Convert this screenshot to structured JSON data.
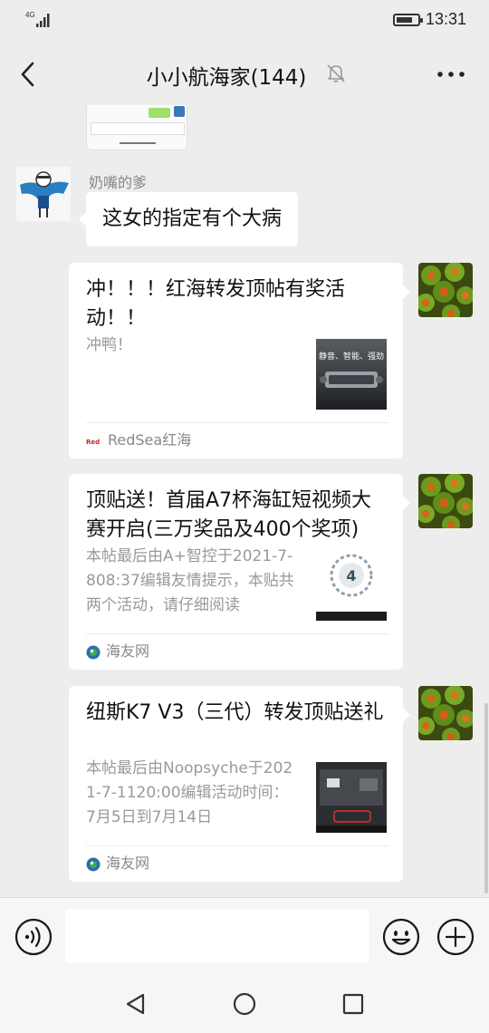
{
  "status_bar": {
    "network": "4G",
    "time": "13:31",
    "battery_level": 0.75
  },
  "header": {
    "title": "小小航海家(144)"
  },
  "messages": {
    "sender_name": "奶嘴的爹",
    "text_message": "这女的指定有个大病"
  },
  "cards": [
    {
      "title": "冲！！！红海转发顶帖有奖活动！！",
      "desc": "冲鸭！",
      "source": "RedSea红海",
      "thumb_text": "静音、智能、强劲"
    },
    {
      "title": "顶贴送！首届A7杯海缸短视频大赛开启(三万奖品及400个奖项)",
      "desc": "本帖最后由A+智控于2021-7-808:37编辑友情提示，本贴共两个活动，请仔细阅读",
      "source": "海友网"
    },
    {
      "title": "纽斯K7 V3（三代）转发顶贴送礼",
      "desc": "本帖最后由Noopsyche于2021-7-1120:00编辑活动时间：7月5日到7月14日",
      "source": "海友网"
    }
  ],
  "colors": {
    "background": "#ededed",
    "bubble": "#ffffff",
    "muted_text": "#999999",
    "name_text": "#888888",
    "toolbar": "#f6f6f6"
  }
}
